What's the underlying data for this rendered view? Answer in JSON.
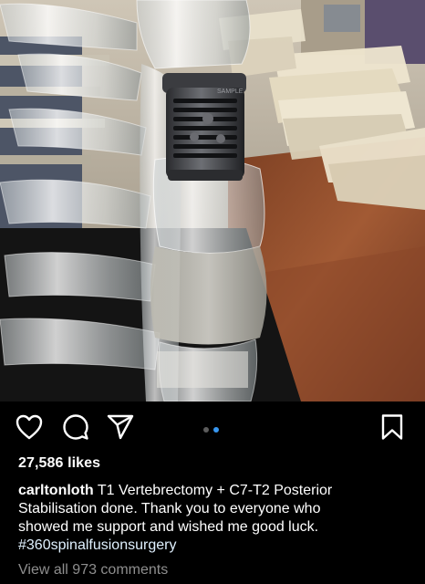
{
  "post": {
    "likes_text": "27,586 likes",
    "username": "carltonloth",
    "caption_line1": "T1 Vertebrectomy + C7-T2 Posterior",
    "caption_line2": "Stabilisation done. Thank you to everyone who",
    "caption_line3": "showed me support and wished me good luck.",
    "hashtag": "#360spinalfusionsurgery",
    "view_comments": "View all 973 comments",
    "cage_label": "SAMPLE"
  },
  "carousel": {
    "total": 2,
    "active_index": 1
  },
  "icons": {
    "like": "heart-icon",
    "comment": "comment-bubble-icon",
    "share": "paper-plane-icon",
    "save": "bookmark-icon"
  },
  "colors": {
    "background": "#000000",
    "text": "#ffffff",
    "muted": "#8e8e8e",
    "active_dot": "#3897f0",
    "inactive_dot": "#5c5c5c"
  }
}
